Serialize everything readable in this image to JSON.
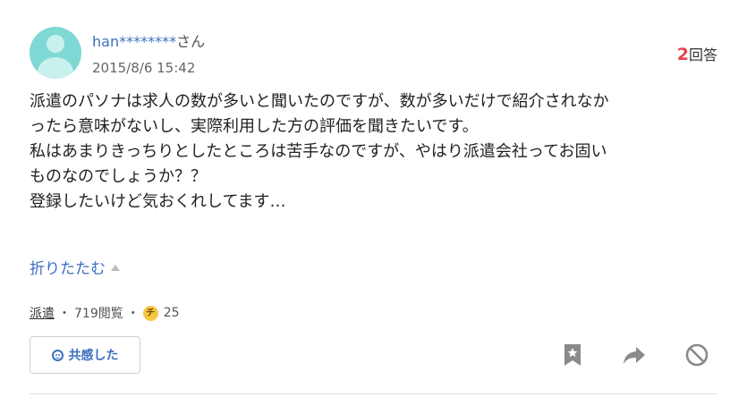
{
  "user": {
    "name": "han********",
    "suffix": "さん",
    "posted_at": "2015/8/6 15:42"
  },
  "answers": {
    "count": "2",
    "label": "回答"
  },
  "question": {
    "lines": [
      "派遣のパソナは求人の数が多いと聞いたのですが、数が多いだけで紹介されなか",
      "ったら意味がないし、実際利用した方の評価を聞きたいです。",
      "私はあまりきっちりとしたところは苦手なのですが、やはり派遣会社ってお固い",
      "ものなのでしょうか？？",
      "登録したいけど気おくれしてます…"
    ]
  },
  "collapse_label": "折りたたむ",
  "meta": {
    "category": "派遣",
    "views": "719閲覧",
    "separator": "・",
    "coin_glyph": "チ",
    "coins": "25"
  },
  "actions": {
    "empathy_label": "共感した",
    "bookmark_icon": "bookmark-icon",
    "share_icon": "share-icon",
    "report_icon": "block-icon"
  },
  "colors": {
    "link": "#3a6fc0",
    "answer_count": "#e0454b",
    "avatar": "#7fd8d4",
    "coin": "#f5c842",
    "icon_gray": "#888888"
  }
}
